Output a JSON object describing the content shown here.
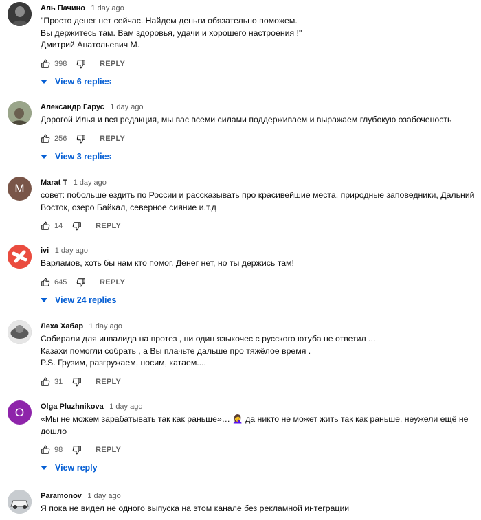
{
  "comments": [
    {
      "author": "Аль Пачино",
      "time": "1 day ago",
      "text": "\"Просто денег нет сейчас. Найдем деньги обязательно поможем.\n Вы держитесь там. Вам здоровья, удачи и хорошего настроения !\"\nДмитрий Анатольевич М.",
      "likes": "398",
      "reply_label": "REPLY",
      "replies_label": "View 6 replies",
      "avatar": {
        "kind": "photo",
        "color": "#2b2b2b"
      }
    },
    {
      "author": "Александр Гарус",
      "time": "1 day ago",
      "text": "Дорогой Илья и вся редакция, мы вас всеми силами поддерживаем и выражаем глубокую озабоченость",
      "likes": "256",
      "reply_label": "REPLY",
      "replies_label": "View 3 replies",
      "avatar": {
        "kind": "photo",
        "color": "#7c8a6a"
      }
    },
    {
      "author": "Marat T",
      "time": "1 day ago",
      "text": "совет: побольше ездить по России и рассказывать про красивейшие места, природные заповедники, Дальний Восток, озеро Байкал, северное сияние и.т.д",
      "likes": "14",
      "reply_label": "REPLY",
      "avatar": {
        "kind": "letter",
        "letter": "M",
        "color": "#795548"
      }
    },
    {
      "author": "ivi",
      "time": "1 day ago",
      "text": "Варламов, хоть бы нам кто помог. Денег нет, но ты держись там!",
      "likes": "645",
      "reply_label": "REPLY",
      "replies_label": "View 24 replies",
      "avatar": {
        "kind": "logo",
        "color": "#ea4c3f"
      }
    },
    {
      "author": "Леха Хабар",
      "time": "1 day ago",
      "text": "Собирали для инвалида на протез , ни один языкочес с русского ютуба не ответил ...\nКазахи помогли собрать , а Вы плачьте дальше про тяжёлое время .\nP.S. Грузим, разгружаем, носим, катаем....",
      "likes": "31",
      "reply_label": "REPLY",
      "avatar": {
        "kind": "photo",
        "color": "#9e9e9e"
      }
    },
    {
      "author": "Olga Pluzhnikova",
      "time": "1 day ago",
      "text": "«Мы не можем зарабатывать так как раньше»… 🤦‍♀️ да никто не может жить так как раньше, неужели ещё не дошло",
      "likes": "98",
      "reply_label": "REPLY",
      "replies_label": "View reply",
      "avatar": {
        "kind": "letter",
        "letter": "O",
        "color": "#8e24aa"
      }
    },
    {
      "author": "Paramonov",
      "time": "1 day ago",
      "text": "Я пока не видел не одного выпуска на этом канале без рекламной интеграции",
      "avatar": {
        "kind": "photo",
        "color": "#b0b4b8"
      }
    }
  ]
}
